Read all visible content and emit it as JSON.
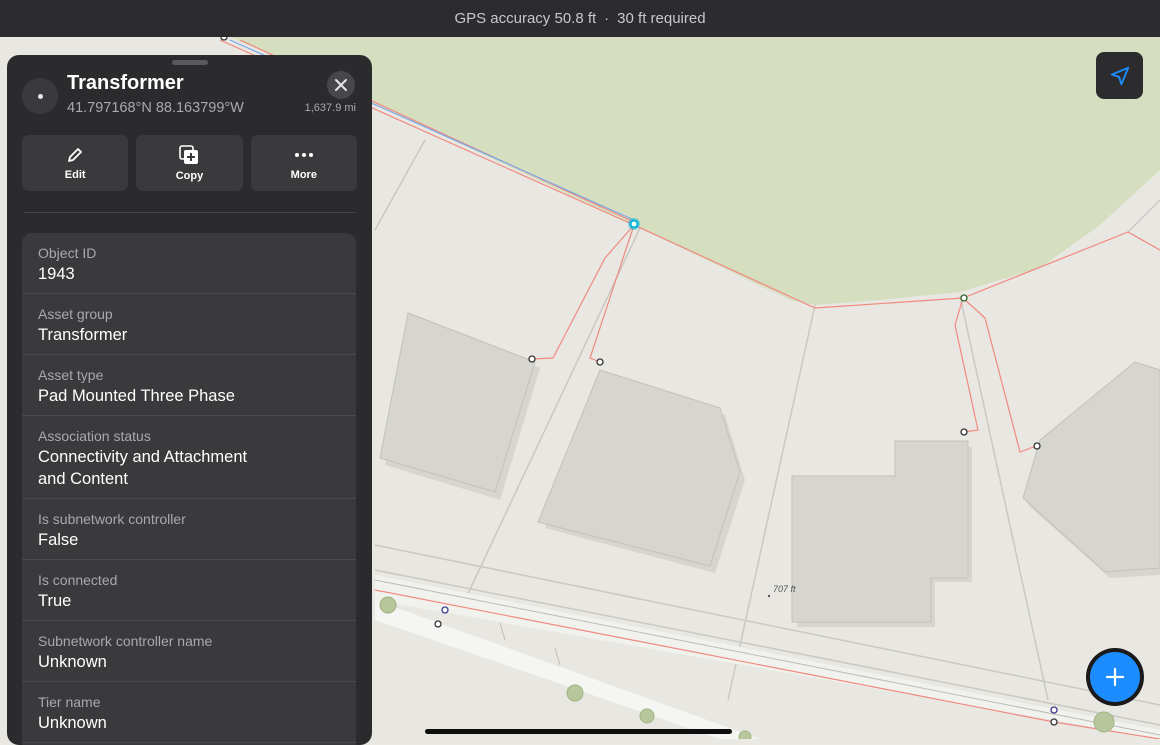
{
  "status_bar": {
    "gps_accuracy": "GPS accuracy 50.8 ft",
    "separator": "·",
    "required": "30 ft required"
  },
  "map": {
    "elevation_label": "707 ft",
    "colors": {
      "green_area": "#d5dfc0",
      "line_red": "#f08a80",
      "line_blue": "#7aa7e8",
      "selected": "#00b4d8"
    }
  },
  "panel": {
    "title": "Transformer",
    "coordinates": "41.797168°N  88.163799°W",
    "distance": "1,637.9 mi",
    "actions": [
      {
        "label": "Edit",
        "icon": "pencil-icon"
      },
      {
        "label": "Copy",
        "icon": "copy-icon"
      },
      {
        "label": "More",
        "icon": "ellipsis-icon"
      }
    ],
    "fields": [
      {
        "label": "Object ID",
        "value": "1943"
      },
      {
        "label": "Asset group",
        "value": "Transformer"
      },
      {
        "label": "Asset type",
        "value": "Pad Mounted Three Phase"
      },
      {
        "label": "Association status",
        "value": "Connectivity and Attachment and Content"
      },
      {
        "label": "Is subnetwork controller",
        "value": "False"
      },
      {
        "label": "Is connected",
        "value": "True"
      },
      {
        "label": "Subnetwork controller name",
        "value": "Unknown"
      },
      {
        "label": "Tier name",
        "value": "Unknown"
      }
    ]
  },
  "fab": {
    "icon": "plus-icon"
  },
  "locate": {
    "icon": "location-arrow-icon"
  },
  "accent_color": "#1c8cff"
}
